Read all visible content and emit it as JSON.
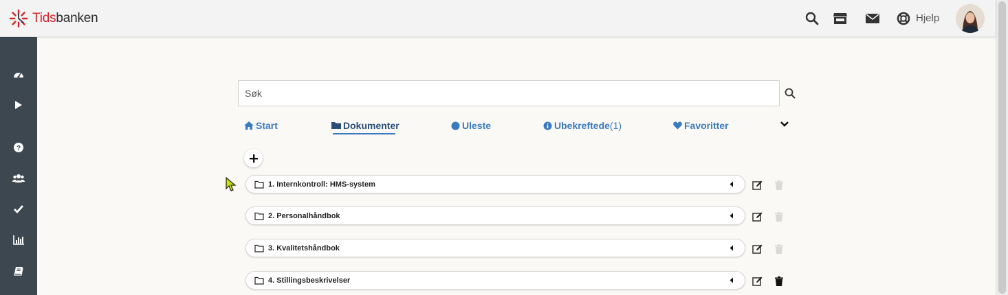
{
  "header": {
    "brand_red": "Tids",
    "brand_dark": "banken",
    "icons": [
      "search-icon",
      "store-icon",
      "mail-icon",
      "lifebuoy-icon"
    ],
    "help_label": "Hjelp"
  },
  "sidebar": {
    "items": [
      "dashboard-icon",
      "play-icon",
      "question-icon",
      "users-icon",
      "check-icon",
      "bar-chart-icon",
      "book-icon"
    ]
  },
  "search": {
    "placeholder": "Søk"
  },
  "tabs": [
    {
      "label": "Start",
      "icon": "home-icon"
    },
    {
      "label": "Dokumenter",
      "icon": "folder-icon",
      "active": true
    },
    {
      "label": "Uleste",
      "icon": "circle-icon"
    },
    {
      "label": "Ubekreftede",
      "count": "(1)",
      "icon": "info-icon"
    },
    {
      "label": "Favoritter",
      "icon": "heart-icon"
    }
  ],
  "folders": [
    {
      "label": "1. Internkontroll: HMS-system",
      "delete_enabled": false
    },
    {
      "label": "2. Personalhåndbok",
      "delete_enabled": false
    },
    {
      "label": "3. Kvalitetshåndbok",
      "delete_enabled": false
    },
    {
      "label": "4. Stillingsbeskrivelser",
      "delete_enabled": true
    }
  ],
  "colors": {
    "brand_red": "#d3242b",
    "link_blue": "#3a7bbf",
    "sidebar_bg": "#3d4750",
    "page_bg": "#fbf9f5"
  }
}
